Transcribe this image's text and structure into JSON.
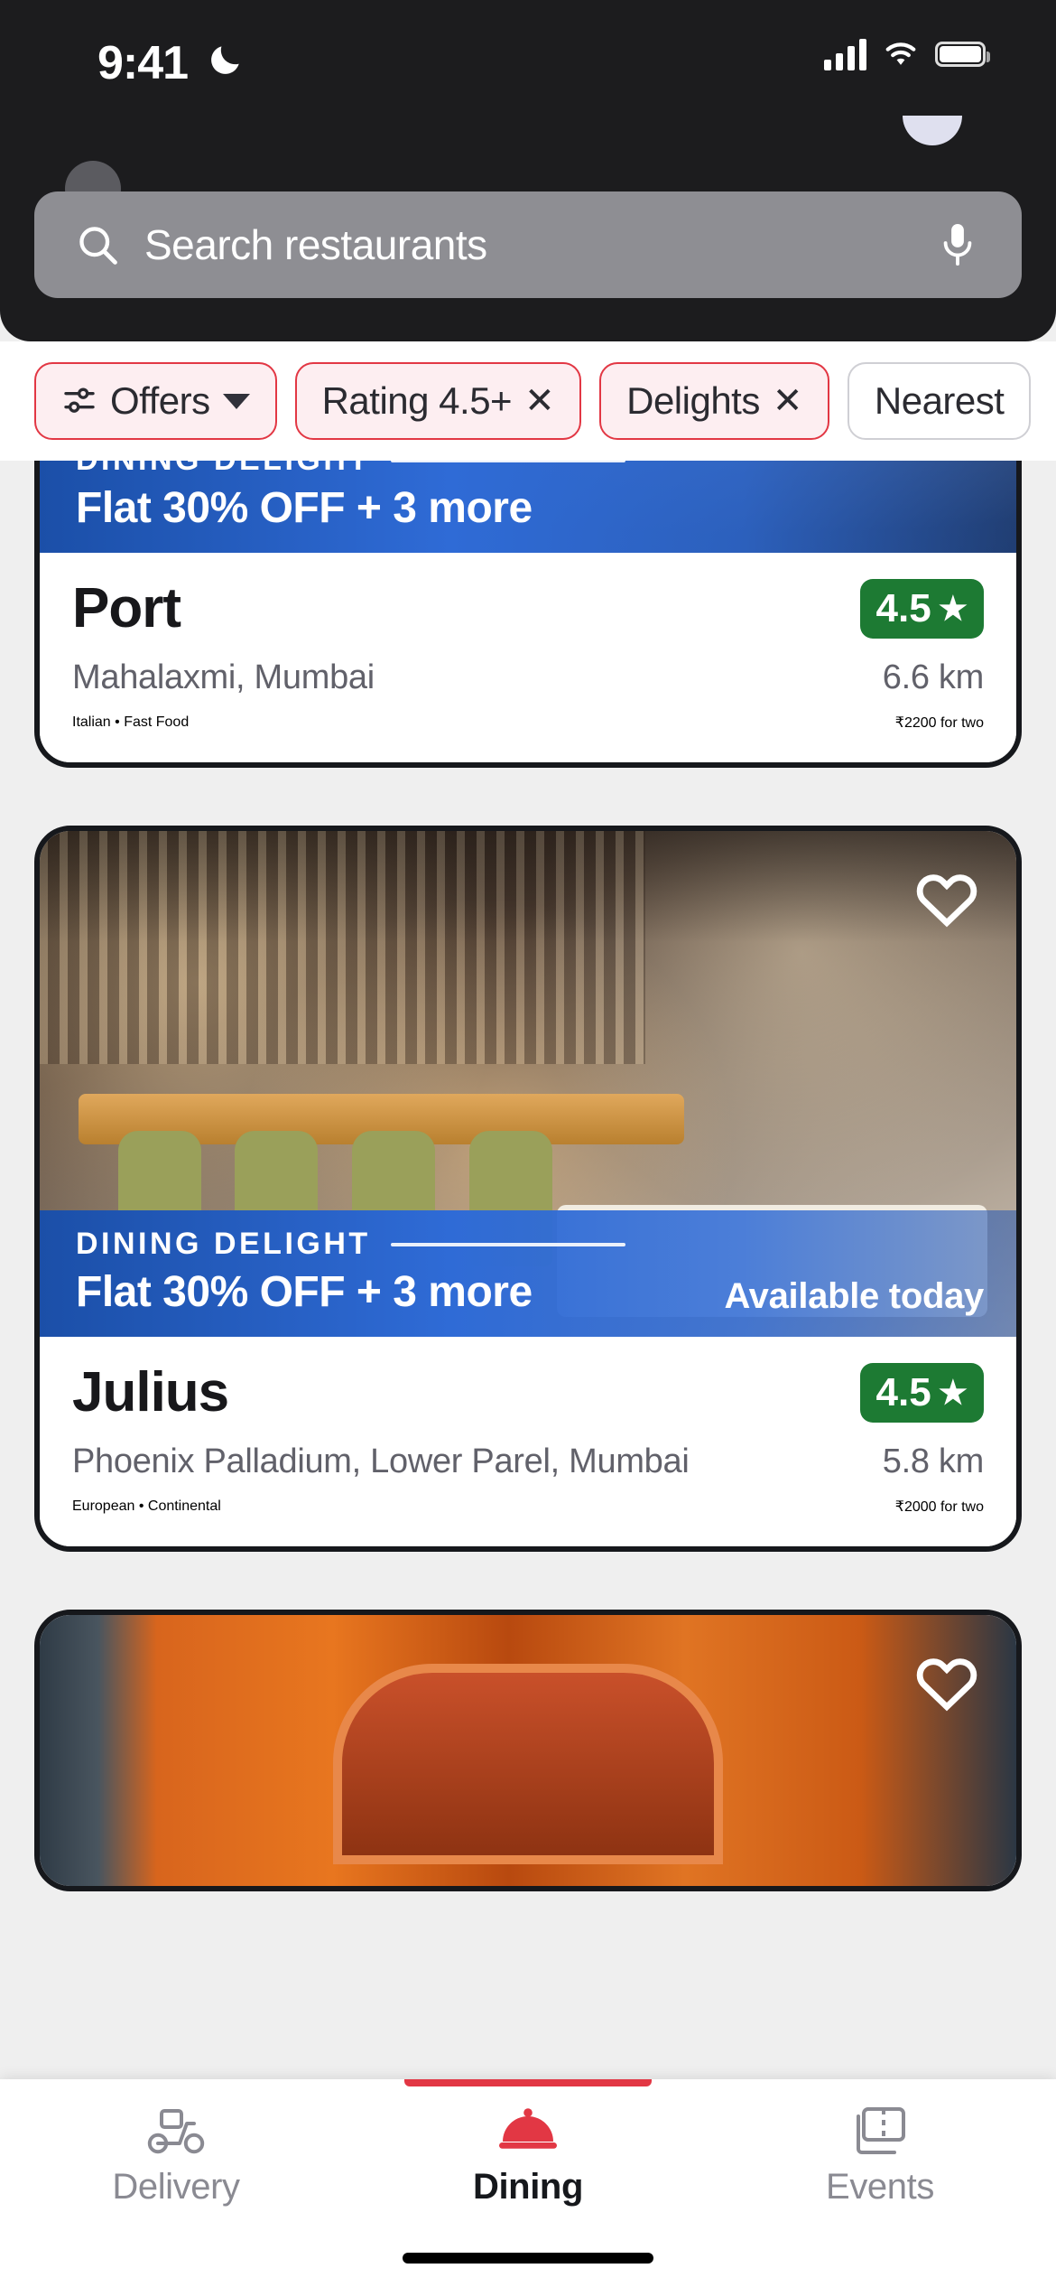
{
  "status_bar": {
    "time": "9:41",
    "dnd_icon": "moon-icon",
    "cellular_icon": "cellular-signal-icon",
    "wifi_icon": "wifi-icon",
    "battery_icon": "battery-icon"
  },
  "search": {
    "placeholder": "Search restaurants",
    "search_icon": "search-icon",
    "mic_icon": "microphone-icon"
  },
  "filters": [
    {
      "label": "Offers",
      "icon": "sliders-icon",
      "trailing": "chevron-down-icon",
      "active": true
    },
    {
      "label": "Rating 4.5+",
      "icon": "",
      "trailing": "close-icon",
      "active": true
    },
    {
      "label": "Delights",
      "icon": "",
      "trailing": "close-icon",
      "active": true
    },
    {
      "label": "Nearest",
      "icon": "",
      "trailing": "",
      "active": false
    }
  ],
  "restaurants": [
    {
      "name": "Port",
      "offer_kicker": "DINING DELIGHT",
      "offer_text": "Flat 30% OFF + 3 more",
      "availability": "",
      "rating": "4.5",
      "rating_star": "★",
      "locality": "Mahalaxmi, Mumbai",
      "distance": "6.6 km",
      "cuisines": "Italian • Fast Food",
      "price": "₹2200 for two"
    },
    {
      "name": "Julius",
      "offer_kicker": "DINING DELIGHT",
      "offer_text": "Flat 30% OFF + 3 more",
      "availability": "Available today",
      "rating": "4.5",
      "rating_star": "★",
      "locality": "Phoenix Palladium, Lower Parel, Mumbai",
      "distance": "5.8 km",
      "cuisines": "European • Continental",
      "price": "₹2000 for two"
    }
  ],
  "tabs": [
    {
      "label": "Delivery",
      "icon": "scooter-icon",
      "active": false
    },
    {
      "label": "Dining",
      "icon": "food-cloche-icon",
      "active": true
    },
    {
      "label": "Events",
      "icon": "tickets-icon",
      "active": false
    }
  ],
  "colors": {
    "brand_red": "#e23744",
    "chip_active_bg": "#fdeef1",
    "rating_green": "#1d7a33",
    "offer_blue": "#2f6bd6",
    "header_dark": "#1c1c1e"
  }
}
